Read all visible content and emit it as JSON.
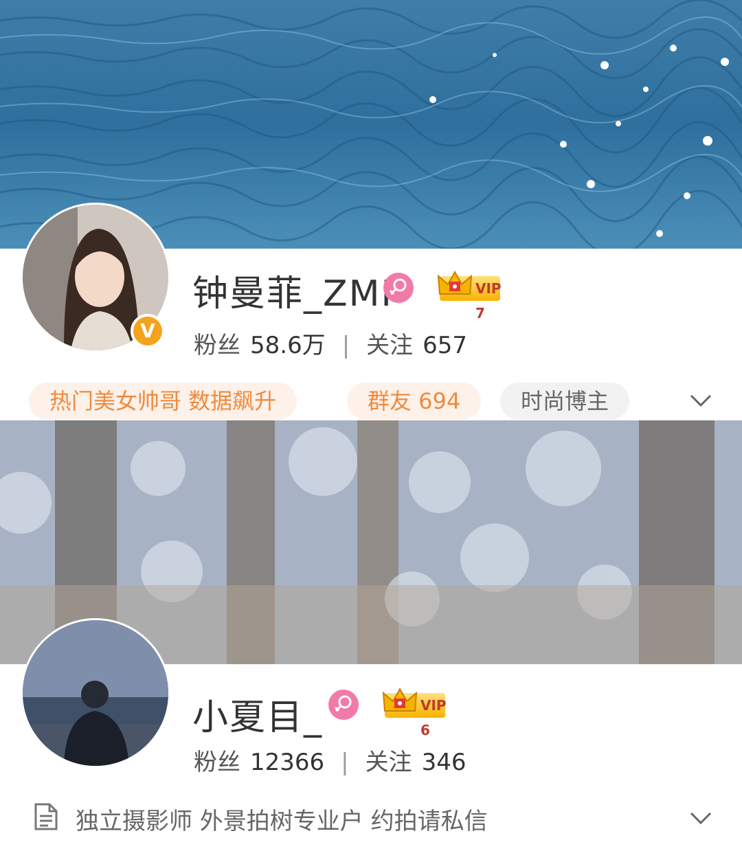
{
  "profiles": [
    {
      "name": "钟曼菲_ZMF",
      "vip_label": "VIP 7",
      "fans_label": "粉丝",
      "fans_count": "58.6万",
      "follow_label": "关注",
      "follow_count": "657",
      "verified": "V",
      "tags": [
        "热门美女帅哥 数据飙升",
        "群友 694",
        "时尚博主"
      ]
    },
    {
      "name": "小夏目_",
      "vip_label": "VIP 6",
      "fans_label": "粉丝",
      "fans_count": "12366",
      "follow_label": "关注",
      "follow_count": "346",
      "description": "独立摄影师 外景拍树专业户 约拍请私信"
    }
  ],
  "colors": {
    "vip_gold": "#f7b300",
    "gender_pink": "#f27aa9",
    "tag_orange": "#f08a3c",
    "verified_orange": "#f4a41c"
  },
  "icons": [
    "chevron-down-icon",
    "document-icon",
    "female-icon",
    "crown-icon",
    "verified-icon"
  ]
}
